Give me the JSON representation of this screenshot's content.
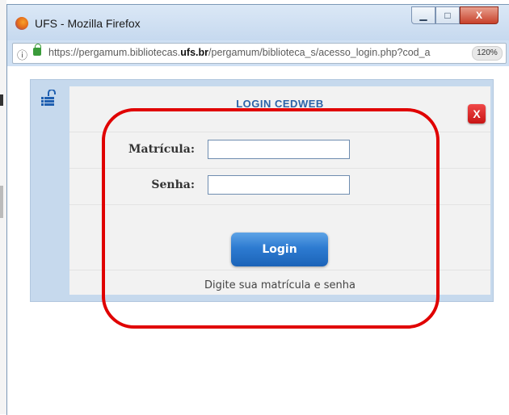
{
  "window": {
    "title": "UFS - Mozilla Firefox",
    "controls": {
      "minimize": "▁",
      "maximize": "□",
      "close": "X"
    }
  },
  "urlbar": {
    "url_prefix": "https://pergamum.bibliotecas.",
    "url_domain": "ufs.br",
    "url_suffix": "/pergamum/biblioteca_s/acesso_login.php?cod_a",
    "zoom": "120%"
  },
  "login": {
    "title": "LOGIN CEDWEB",
    "close_label": "X",
    "matricula_label": "Matrícula:",
    "matricula_value": "",
    "senha_label": "Senha:",
    "senha_value": "",
    "submit_label": "Login",
    "hint": "Digite sua matrícula e senha"
  },
  "colors": {
    "highlight": "#e00000",
    "title": "#2c63a8",
    "button": "#2d7bd1",
    "close": "#d41c1c"
  }
}
